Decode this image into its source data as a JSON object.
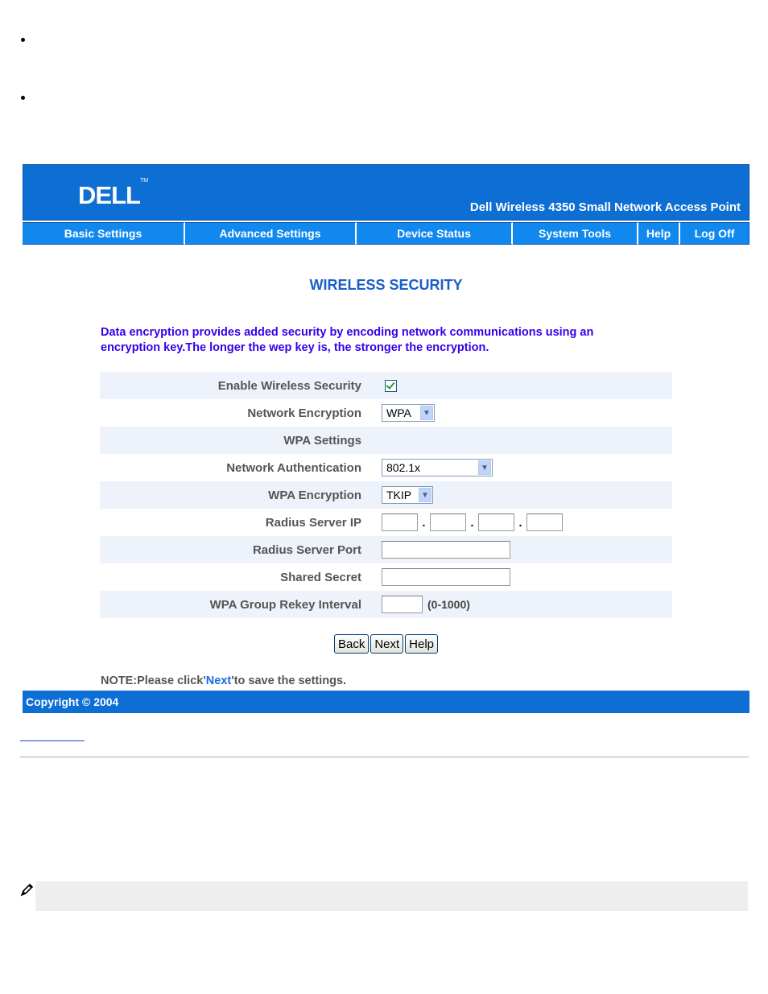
{
  "header": {
    "logo_text": "DELL",
    "logo_tm": "TM",
    "product_name": "Dell Wireless 4350 Small Network Access Point",
    "brand_color": "#0d6fd4"
  },
  "nav": {
    "items": [
      {
        "label": "Basic Settings"
      },
      {
        "label": "Advanced Settings"
      },
      {
        "label": "Device Status"
      },
      {
        "label": "System Tools"
      },
      {
        "label": "Help"
      },
      {
        "label": "Log Off"
      }
    ]
  },
  "page": {
    "title": "WIRELESS SECURITY",
    "intro": "Data encryption provides added security by encoding network communications using an encryption key.The longer the wep key is, the stronger the encryption."
  },
  "form": {
    "enable_security_label": "Enable Wireless Security",
    "enable_security_checked": true,
    "network_encryption_label": "Network Encryption",
    "network_encryption_value": "WPA",
    "wpa_settings_label": "WPA Settings",
    "network_auth_label": "Network Authentication",
    "network_auth_value": "802.1x",
    "wpa_encryption_label": "WPA Encryption",
    "wpa_encryption_value": "TKIP",
    "radius_ip_label": "Radius Server IP",
    "radius_ip_octets": [
      "",
      "",
      "",
      ""
    ],
    "ip_separator": ".",
    "radius_port_label": "Radius Server Port",
    "radius_port_value": "",
    "shared_secret_label": "Shared Secret",
    "shared_secret_value": "",
    "rekey_label": "WPA Group Rekey Interval",
    "rekey_value": "",
    "rekey_range": "(0-1000)"
  },
  "buttons": {
    "back": "Back",
    "next": "Next",
    "help": "Help"
  },
  "note": {
    "prefix": "NOTE:Please click",
    "quote_open": "'",
    "highlight": "Next",
    "quote_close": "'",
    "suffix": "to save the settings."
  },
  "footer": {
    "copyright": "Copyright © 2004"
  },
  "icons": {
    "note_icon": "pencil-note-icon",
    "dropdown": "chevron-down-icon"
  }
}
